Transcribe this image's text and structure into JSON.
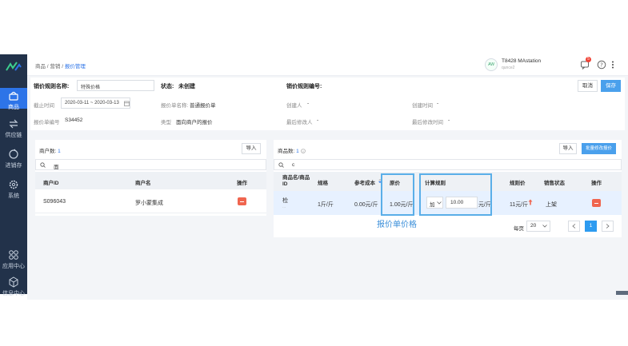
{
  "sidebar": {
    "items": [
      {
        "label": "商品",
        "icon": "basket-icon"
      },
      {
        "label": "供应链",
        "icon": "exchange-icon"
      },
      {
        "label": "进销存",
        "icon": "cycle-icon"
      },
      {
        "label": "系统",
        "icon": "gear-icon"
      },
      {
        "label": "应用中心",
        "icon": "apps-icon"
      },
      {
        "label": "信息中心",
        "icon": "cube-icon"
      }
    ]
  },
  "header": {
    "breadcrumb": [
      "商品",
      "营销",
      "报价管理"
    ],
    "user_name": "T8428 MAstation",
    "user_sub": "qunce2",
    "avatar_text": "AW",
    "notif_count": "5"
  },
  "form": {
    "name_label": "销价规则名称:",
    "name_value": "特殊价格",
    "status_label": "状态:",
    "status_value": "未创建",
    "rule_no_label": "销价规则编号:",
    "deadline_label": "截止时间",
    "date_range": "2020-03-11 ~ 2020-03-13",
    "quote_name_label": "报价单名称:",
    "quote_name_value": "普通报价单",
    "creator_label": "创建人",
    "creator_value": "-",
    "created_time_label": "创建时间",
    "created_time_value": "-",
    "quote_no_label": "报价单编号",
    "quote_no_value": "S34452",
    "type_label": "类型",
    "type_value": "面向商户的报价",
    "modifier_label": "最后修改人",
    "modifier_value": "-",
    "modified_time_label": "最后修改时间",
    "modified_time_value": "-",
    "cancel_label": "取消",
    "save_label": "保存"
  },
  "merchants": {
    "count_label": "商户数:",
    "count_value": "1",
    "import_label": "导入",
    "search_value": "面",
    "columns": [
      "商户ID",
      "商户名",
      "操作"
    ],
    "rows": [
      {
        "id": "S096043",
        "name": "罗小蒙集成"
      }
    ]
  },
  "products": {
    "count_label": "商品数:",
    "count_value": "1",
    "import_label": "导入",
    "batch_label": "批量修改报价",
    "search_value": "c",
    "columns": [
      "商品名/商品ID",
      "规格",
      "参考成本",
      "原价",
      "计算规则",
      "规则价",
      "销售状态",
      "操作"
    ],
    "rows": [
      {
        "name": "检",
        "sub_id": "...",
        "spec": "1斤/斤",
        "cost": "0.00元/斤",
        "price": "1.00元/斤",
        "rule_op": "加",
        "rule_value": "10.00",
        "rule_unit": "元/斤",
        "rule_price": "11元/斤",
        "sale_status": "上架"
      }
    ],
    "callout_label": "报价单价格",
    "page_size_label": "每页",
    "page_size": "20",
    "current_page": "1"
  },
  "colors": {
    "sidebar": "#22324a",
    "primary": "#2d74e8",
    "accent_button": "#4aa0ec",
    "delete": "#f0654f",
    "callout": "#5aaee8"
  }
}
